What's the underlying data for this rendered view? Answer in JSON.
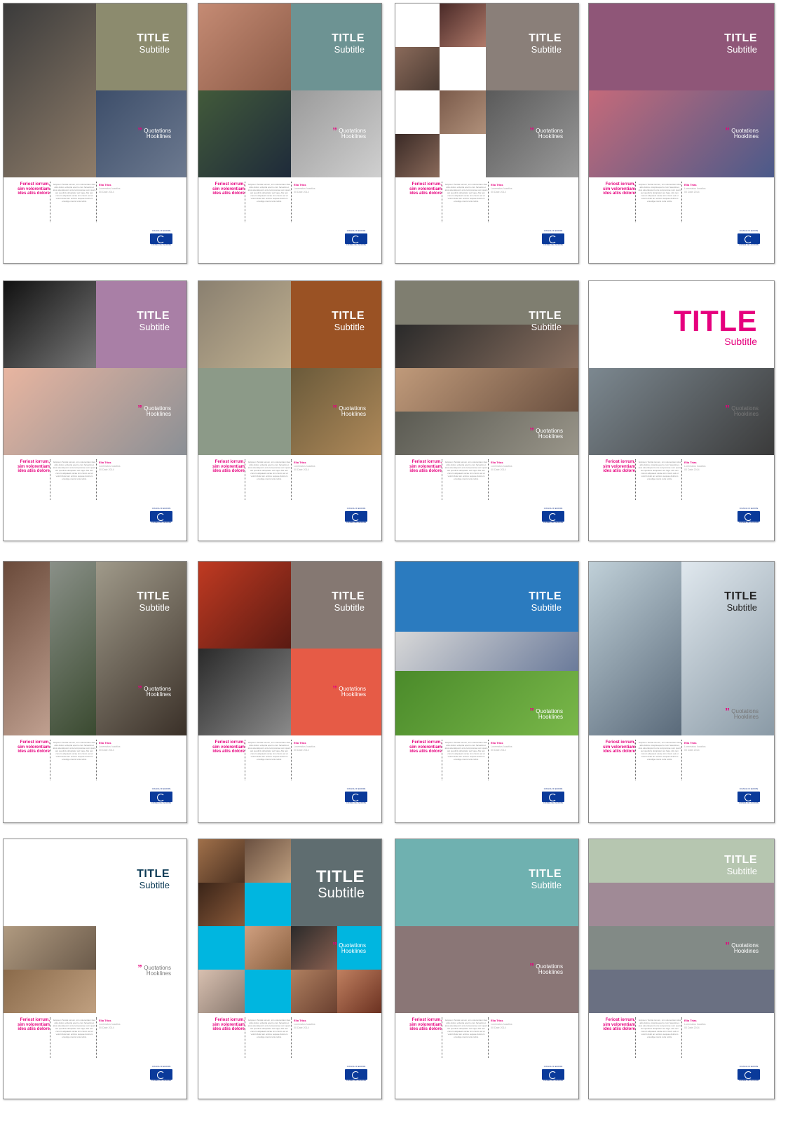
{
  "common": {
    "title": "TITLE",
    "subtitle": "Subtitle",
    "quote": "Quotations",
    "hookline": "Hooklines",
    "footer_heading": [
      "Feriost iorrum,",
      "sim volorentiam",
      "ides atiis dolore"
    ],
    "lorem": "Iscipsum Tenitat iumum, sim volorentiam ides atiis dolore voluptia eperro cum facestimet, atus aloeratquunt ente temporerae sum quam aut quodicis doluptatur aut fuga. Alis tem conum aliquaest uscae sim cisum aut et volorit dolet am entiore sequae dolorem ersudige nienis reria nobis.",
    "author_name": "Elia Trias",
    "author_role": "Lorematos Iuaatios",
    "author_date": "00 Date 2014",
    "logo_top": "COUNCIL OF EUROPE",
    "logo_bottom": "CONSEIL DE L'EUROPE"
  },
  "colors": {
    "magenta": "#e6007e",
    "logo_blue": "#0a3a9a"
  }
}
